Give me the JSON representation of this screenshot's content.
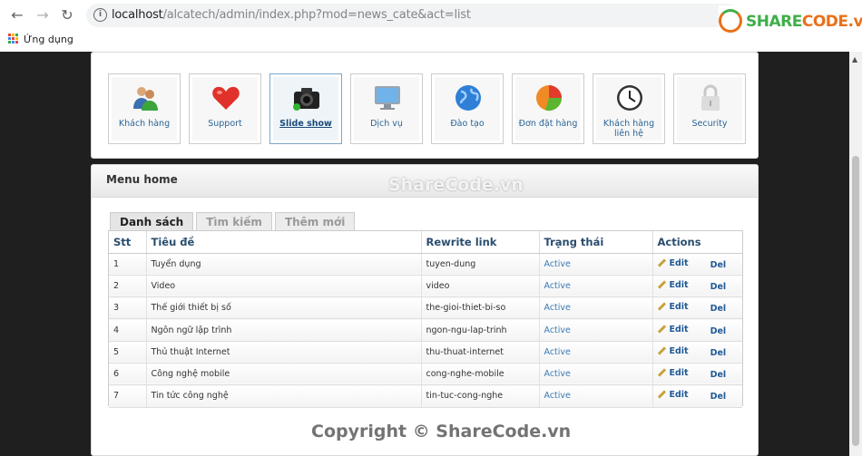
{
  "browser": {
    "url_host": "localhost",
    "url_path": "/alcatech/admin/index.php?mod=news_cate&act=list",
    "apps_label": "Ứng dụng",
    "brand": {
      "left": "SHARE",
      "right": "CODE.vn"
    }
  },
  "toolbar": [
    {
      "label": "Khách hàng",
      "icon": "customers-icon"
    },
    {
      "label": "Support",
      "icon": "heart-icon"
    },
    {
      "label": "Slide show",
      "icon": "camera-icon",
      "active": true
    },
    {
      "label": "Dịch vụ",
      "icon": "monitor-icon"
    },
    {
      "label": "Đào tạo",
      "icon": "globe-icon"
    },
    {
      "label": "Đơn đặt hàng",
      "icon": "pie-chart-icon"
    },
    {
      "label": "Khách hàng liên hệ",
      "icon": "clock-icon"
    },
    {
      "label": "Security",
      "icon": "lock-icon"
    }
  ],
  "panel": {
    "title": "Menu home"
  },
  "tabs": [
    {
      "label": "Danh sách",
      "active": true
    },
    {
      "label": "Tìm kiếm"
    },
    {
      "label": "Thêm mới"
    }
  ],
  "table": {
    "headers": [
      "Stt",
      "Tiêu đề",
      "Rewrite link",
      "Trạng thái",
      "Actions"
    ],
    "edit_label": "Edit",
    "del_label": "Del",
    "rows": [
      {
        "stt": "1",
        "title": "Tuyển dụng",
        "link": "tuyen-dung",
        "status": "Active"
      },
      {
        "stt": "2",
        "title": "Video",
        "link": "video",
        "status": "Active"
      },
      {
        "stt": "3",
        "title": "Thế giới thiết bị số",
        "link": "the-gioi-thiet-bi-so",
        "status": "Active"
      },
      {
        "stt": "4",
        "title": "Ngôn ngữ lập trình",
        "link": "ngon-ngu-lap-trinh",
        "status": "Active"
      },
      {
        "stt": "5",
        "title": "Thủ thuật Internet",
        "link": "thu-thuat-internet",
        "status": "Active"
      },
      {
        "stt": "6",
        "title": "Công nghệ mobile",
        "link": "cong-nghe-mobile",
        "status": "Active"
      },
      {
        "stt": "7",
        "title": "Tin tức công nghệ",
        "link": "tin-tuc-cong-nghe",
        "status": "Active"
      }
    ]
  },
  "watermarks": {
    "center": "ShareCode.vn",
    "bottom": "Copyright © ShareCode.vn"
  }
}
